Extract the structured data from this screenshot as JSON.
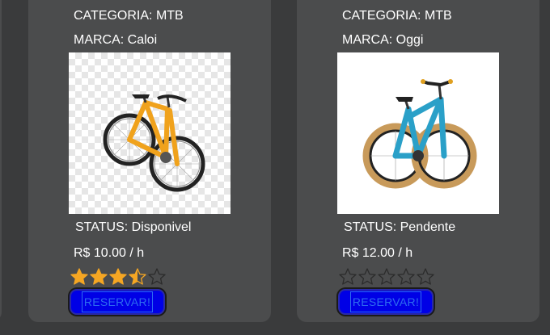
{
  "cards": [
    {
      "category": "CATEGORIA: MTB",
      "brand": "MARCA: Caloi",
      "status": "STATUS: Disponivel",
      "price": "R$ 10.00 / h",
      "rating": 3.5,
      "rating_max": 5,
      "button": "RESERVAR!",
      "image_icon": "orange-mountain-bike-photo",
      "accent": "#f0a21c"
    },
    {
      "category": "CATEGORIA: MTB",
      "brand": "MARCA: Oggi",
      "status": "STATUS: Pendente",
      "price": "R$ 12.00 / h",
      "rating": 0,
      "rating_max": 5,
      "button": "RESERVAR!",
      "image_icon": "blue-kids-bike-photo",
      "accent": "#2aa0c8"
    }
  ],
  "colors": {
    "background": "#3a3b3c",
    "card": "#4b4c4d",
    "star_filled": "#f5a623",
    "button": "#0000e6"
  }
}
